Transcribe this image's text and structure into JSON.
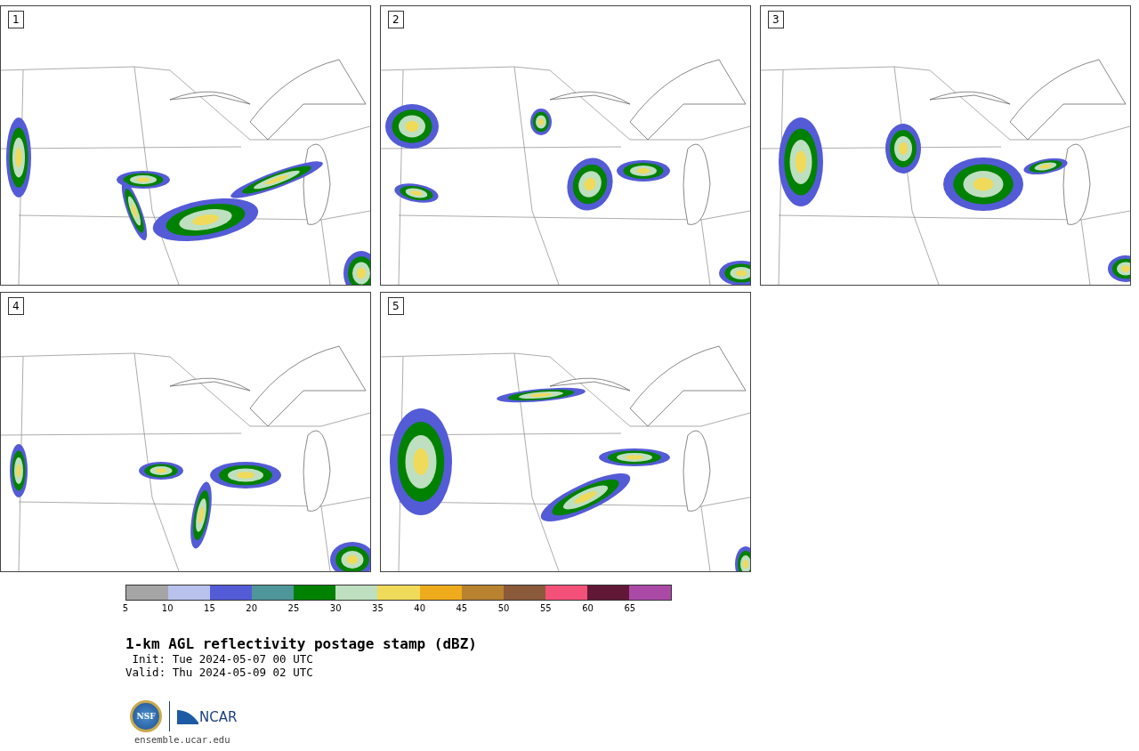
{
  "panels": [
    {
      "label": "1"
    },
    {
      "label": "2"
    },
    {
      "label": "3"
    },
    {
      "label": "4"
    },
    {
      "label": "5"
    }
  ],
  "colorbar": {
    "segments": [
      {
        "color": "#a5a5a5"
      },
      {
        "color": "#b8c2ec"
      },
      {
        "color": "#545bd6"
      },
      {
        "color": "#4f969b"
      },
      {
        "color": "#008100"
      },
      {
        "color": "#bedfc0"
      },
      {
        "color": "#f0da5a"
      },
      {
        "color": "#eeab1b"
      },
      {
        "color": "#b8822f"
      },
      {
        "color": "#8a5a3b"
      },
      {
        "color": "#f45179"
      },
      {
        "color": "#611736"
      },
      {
        "color": "#ab4aa6"
      }
    ],
    "ticks": [
      "5",
      "10",
      "15",
      "20",
      "25",
      "30",
      "35",
      "40",
      "45",
      "50",
      "55",
      "60",
      "65"
    ]
  },
  "title": "1-km AGL reflectivity postage stamp (dBZ)",
  "times": [
    "Init: Tue 2024-05-07 00 UTC",
    "Valid: Thu 2024-05-09 02 UTC"
  ],
  "logos": {
    "nsf": "NSF",
    "ncar": "NCAR"
  },
  "url": "ensemble.ucar.edu"
}
